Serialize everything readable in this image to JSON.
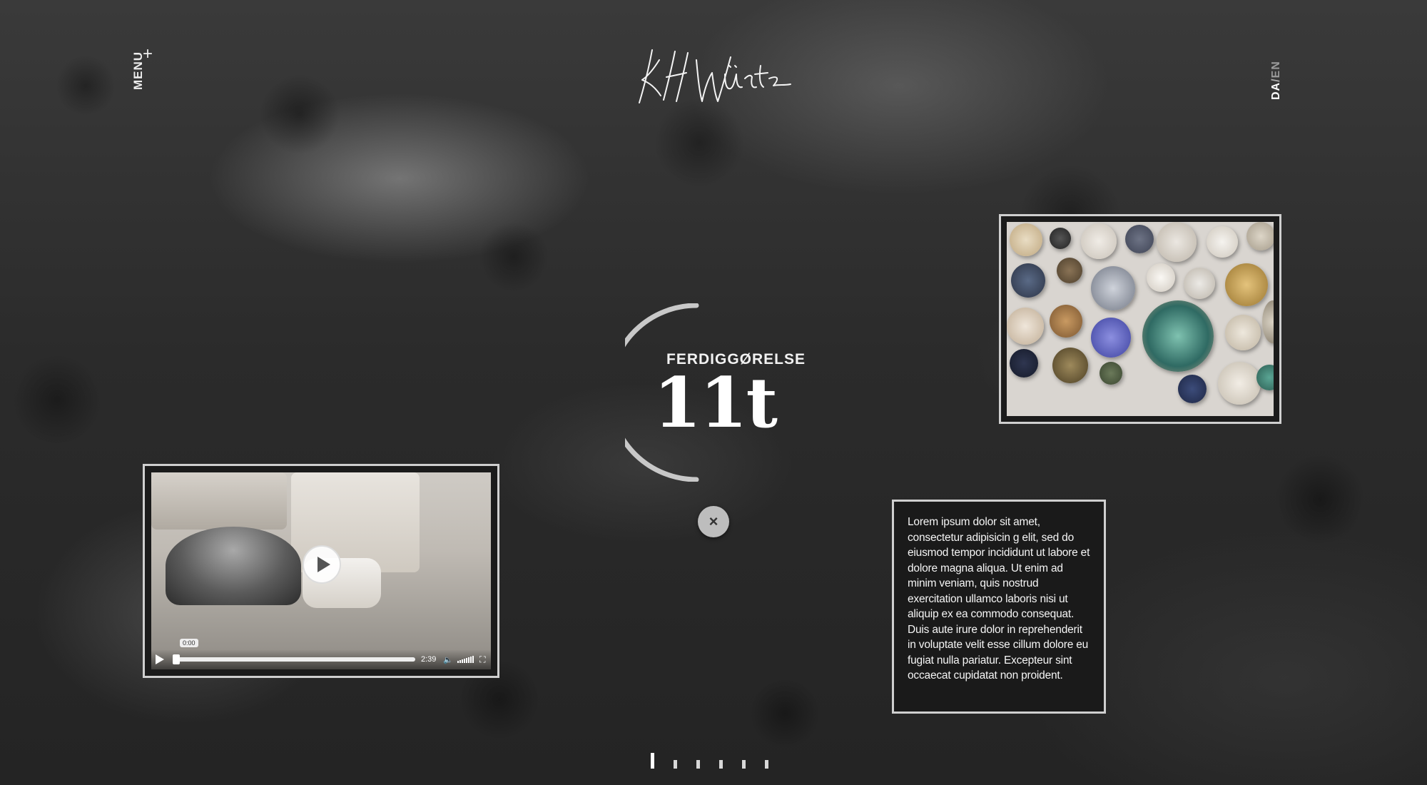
{
  "nav": {
    "menu_label": "MENU",
    "menu_plus": "+",
    "logo_alt": "KH Würtz",
    "lang_da": "DA",
    "lang_sep": "/",
    "lang_en": "EN"
  },
  "stat": {
    "label": "FERDIGGØRELSE",
    "value": "11t",
    "progress": 0.5
  },
  "close": {
    "symbol": "×"
  },
  "video": {
    "time": "2:39",
    "tooltip": "0:00",
    "progress": 0
  },
  "text": {
    "body": "Lorem ipsum dolor sit amet, consectetur adipisicin g elit, sed do eiusmod tempor incididunt ut labore et dolore magna aliqua. Ut enim ad minim veniam, quis nostrud exercitation ullamco laboris nisi ut aliquip ex ea commodo consequat. Duis aute irure dolor in reprehenderit in voluptate velit esse cillum dolore eu fugiat nulla pariatur. Excepteur sint occaecat cupidatat non proident."
  },
  "pager": {
    "count": 6,
    "active_index": 0
  },
  "colors": {
    "frame": "#cfcfcf",
    "background": "#2b2b2b",
    "accent": "#ffffff"
  }
}
